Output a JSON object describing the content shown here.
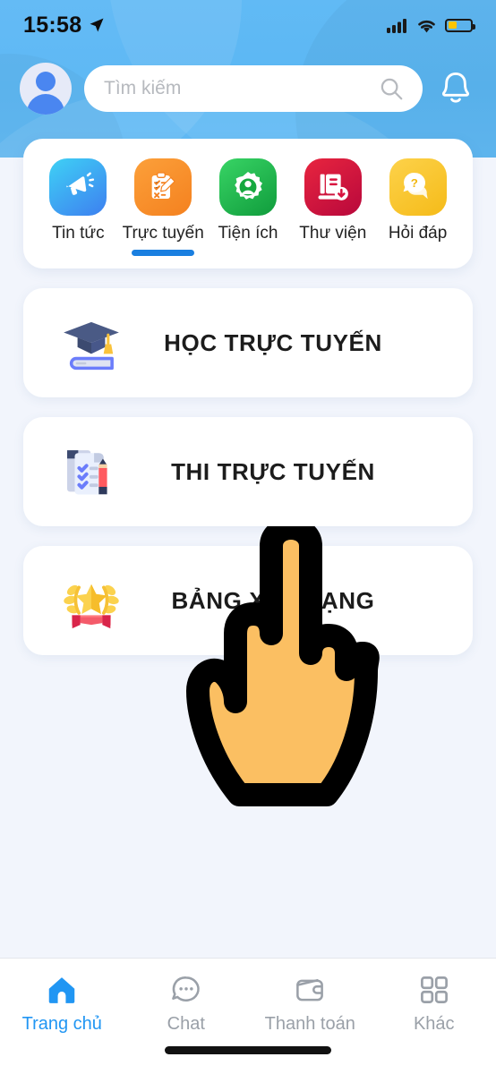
{
  "status_bar": {
    "time": "15:58",
    "location_icon": "location-arrow-icon",
    "signal_icon": "cellular-signal-icon",
    "wifi_icon": "wifi-icon",
    "battery_icon": "battery-low-power-icon",
    "battery_color": "#fdc500"
  },
  "header": {
    "background_color": "#4fb2f3",
    "avatar_icon": "user-avatar-icon",
    "search": {
      "placeholder": "Tìm kiếm",
      "value": "",
      "icon": "search-icon"
    },
    "notification_icon": "bell-icon"
  },
  "categories": {
    "active_index": 1,
    "items": [
      {
        "label": "Tin tức",
        "icon": "megaphone-icon",
        "color_from": "#3fd1f5",
        "color_to": "#3d7ff0"
      },
      {
        "label": "Trực tuyến",
        "icon": "clipboard-pencil-icon",
        "color_from": "#fca03a",
        "color_to": "#f4811f"
      },
      {
        "label": "Tiện ích",
        "icon": "gear-user-icon",
        "color_from": "#38d465",
        "color_to": "#109c3c"
      },
      {
        "label": "Thư viện",
        "icon": "book-download-icon",
        "color_from": "#e8253f",
        "color_to": "#b8083c"
      },
      {
        "label": "Hỏi đáp",
        "icon": "question-chat-icon",
        "color_from": "#fdd24a",
        "color_to": "#f5bb19"
      }
    ],
    "active_indicator_color": "#1a7fe0"
  },
  "menu_cards": [
    {
      "label": "HỌC TRỰC TUYẾN",
      "icon": "graduation-cap-book-icon"
    },
    {
      "label": "THI TRỰC TUYẾN",
      "icon": "checklist-pencil-icon"
    },
    {
      "label": "BẢNG XẾP HẠNG",
      "icon": "award-laurel-ribbon-icon"
    }
  ],
  "cursor": {
    "icon": "pointing-hand-cursor",
    "fill_color": "#fbbf62",
    "outline_color": "#000000"
  },
  "tab_bar": {
    "active_index": 0,
    "active_color": "#2196f3",
    "inactive_color": "#9aa0a8",
    "items": [
      {
        "label": "Trang chủ",
        "icon": "home-icon"
      },
      {
        "label": "Chat",
        "icon": "chat-bubble-icon"
      },
      {
        "label": "Thanh toán",
        "icon": "wallet-icon"
      },
      {
        "label": "Khác",
        "icon": "grid-more-icon"
      }
    ]
  }
}
